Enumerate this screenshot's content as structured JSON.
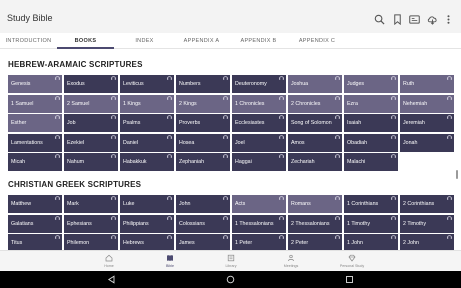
{
  "app": {
    "title": "Study Bible"
  },
  "toolbar": {
    "icons": [
      "search-icon",
      "bookmark-icon",
      "translation-icon",
      "cloud-download-icon",
      "more-vert-icon"
    ]
  },
  "tabs": [
    {
      "label": "INTRODUCTION",
      "active": false
    },
    {
      "label": "BOOKS",
      "active": true
    },
    {
      "label": "INDEX",
      "active": false
    },
    {
      "label": "APPENDIX A",
      "active": false
    },
    {
      "label": "APPENDIX B",
      "active": false
    },
    {
      "label": "APPENDIX C",
      "active": false
    }
  ],
  "colors": {
    "dark": "#3b3956",
    "light": "#6b6585",
    "accent": "#4c4a70"
  },
  "sections": [
    {
      "title": "HEBREW-ARAMAIC SCRIPTURES",
      "books": [
        {
          "name": "Genesis",
          "tone": "light",
          "audio": true
        },
        {
          "name": "Exodus",
          "tone": "dark",
          "audio": true
        },
        {
          "name": "Leviticus",
          "tone": "dark",
          "audio": true
        },
        {
          "name": "Numbers",
          "tone": "dark",
          "audio": true
        },
        {
          "name": "Deuteronomy",
          "tone": "dark",
          "audio": true
        },
        {
          "name": "Joshua",
          "tone": "light",
          "audio": true
        },
        {
          "name": "Judges",
          "tone": "light",
          "audio": true
        },
        {
          "name": "Ruth",
          "tone": "light",
          "audio": true
        },
        {
          "name": "1 Samuel",
          "tone": "light",
          "audio": true
        },
        {
          "name": "2 Samuel",
          "tone": "light",
          "audio": true
        },
        {
          "name": "1 Kings",
          "tone": "light",
          "audio": true
        },
        {
          "name": "2 Kings",
          "tone": "light",
          "audio": true
        },
        {
          "name": "1 Chronicles",
          "tone": "light",
          "audio": true
        },
        {
          "name": "2 Chronicles",
          "tone": "light",
          "audio": true
        },
        {
          "name": "Ezra",
          "tone": "light",
          "audio": true
        },
        {
          "name": "Nehemiah",
          "tone": "light",
          "audio": true
        },
        {
          "name": "Esther",
          "tone": "light",
          "audio": true
        },
        {
          "name": "Job",
          "tone": "dark",
          "audio": true
        },
        {
          "name": "Psalms",
          "tone": "dark",
          "audio": true
        },
        {
          "name": "Proverbs",
          "tone": "dark",
          "audio": true
        },
        {
          "name": "Ecclesiastes",
          "tone": "dark",
          "audio": true
        },
        {
          "name": "Song of Solomon",
          "tone": "dark",
          "audio": true
        },
        {
          "name": "Isaiah",
          "tone": "dark",
          "audio": true
        },
        {
          "name": "Jeremiah",
          "tone": "dark",
          "audio": true
        },
        {
          "name": "Lamentations",
          "tone": "dark",
          "audio": true
        },
        {
          "name": "Ezekiel",
          "tone": "dark",
          "audio": true
        },
        {
          "name": "Daniel",
          "tone": "dark",
          "audio": true
        },
        {
          "name": "Hosea",
          "tone": "dark",
          "audio": true
        },
        {
          "name": "Joel",
          "tone": "dark",
          "audio": true
        },
        {
          "name": "Amos",
          "tone": "dark",
          "audio": true
        },
        {
          "name": "Obadiah",
          "tone": "dark",
          "audio": true
        },
        {
          "name": "Jonah",
          "tone": "dark",
          "audio": true
        },
        {
          "name": "Micah",
          "tone": "dark",
          "audio": true
        },
        {
          "name": "Nahum",
          "tone": "dark",
          "audio": true
        },
        {
          "name": "Habakkuk",
          "tone": "dark",
          "audio": true
        },
        {
          "name": "Zephaniah",
          "tone": "dark",
          "audio": true
        },
        {
          "name": "Haggai",
          "tone": "dark",
          "audio": true
        },
        {
          "name": "Zechariah",
          "tone": "dark",
          "audio": true
        },
        {
          "name": "Malachi",
          "tone": "dark",
          "audio": true
        }
      ]
    },
    {
      "title": "CHRISTIAN GREEK SCRIPTURES",
      "books": [
        {
          "name": "Matthew",
          "tone": "dark",
          "audio": true
        },
        {
          "name": "Mark",
          "tone": "dark",
          "audio": true
        },
        {
          "name": "Luke",
          "tone": "dark",
          "audio": true
        },
        {
          "name": "John",
          "tone": "dark",
          "audio": true
        },
        {
          "name": "Acts",
          "tone": "light",
          "audio": true
        },
        {
          "name": "Romans",
          "tone": "light",
          "audio": true
        },
        {
          "name": "1 Corinthians",
          "tone": "dark",
          "audio": true
        },
        {
          "name": "2 Corinthians",
          "tone": "dark",
          "audio": true
        },
        {
          "name": "Galatians",
          "tone": "dark",
          "audio": true
        },
        {
          "name": "Ephesians",
          "tone": "dark",
          "audio": true
        },
        {
          "name": "Philippians",
          "tone": "dark",
          "audio": true
        },
        {
          "name": "Colossians",
          "tone": "dark",
          "audio": true
        },
        {
          "name": "1 Thessalonians",
          "tone": "dark",
          "audio": true
        },
        {
          "name": "2 Thessalonians",
          "tone": "dark",
          "audio": true
        },
        {
          "name": "1 Timothy",
          "tone": "dark",
          "audio": true
        },
        {
          "name": "2 Timothy",
          "tone": "dark",
          "audio": true
        },
        {
          "name": "Titus",
          "tone": "dark",
          "audio": true
        },
        {
          "name": "Philemon",
          "tone": "dark",
          "audio": true
        },
        {
          "name": "Hebrews",
          "tone": "dark",
          "audio": true
        },
        {
          "name": "James",
          "tone": "dark",
          "audio": true
        },
        {
          "name": "1 Peter",
          "tone": "dark",
          "audio": true
        },
        {
          "name": "2 Peter",
          "tone": "dark",
          "audio": true
        },
        {
          "name": "1 John",
          "tone": "dark",
          "audio": true
        },
        {
          "name": "2 John",
          "tone": "dark",
          "audio": true
        }
      ]
    }
  ],
  "bottom_nav": [
    {
      "label": "Home",
      "icon": "home-icon",
      "active": false
    },
    {
      "label": "Bible",
      "icon": "bible-icon",
      "active": true
    },
    {
      "label": "Library",
      "icon": "library-icon",
      "active": false
    },
    {
      "label": "Meetings",
      "icon": "meetings-icon",
      "active": false
    },
    {
      "label": "Personal Study",
      "icon": "personal-study-icon",
      "active": false
    }
  ],
  "system_nav": [
    "back-icon",
    "home-circle-icon",
    "recents-icon"
  ]
}
